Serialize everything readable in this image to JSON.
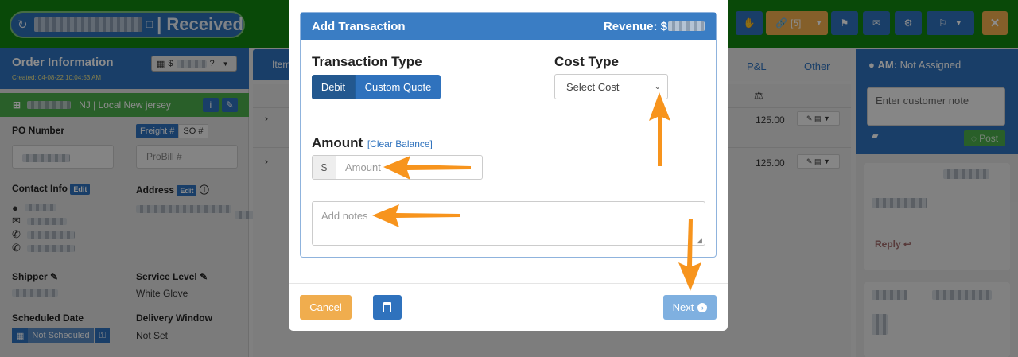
{
  "header": {
    "order_status": "Received",
    "toolbar": {
      "link_count": "[5]"
    }
  },
  "left_panel": {
    "title": "Order Information",
    "created": "Created: 04-08-22 10:04:53 AM",
    "price_dropdown": "$",
    "location": "NJ | Local New jersey",
    "po_number_label": "PO Number",
    "freight_label": "Freight #",
    "so_label": "SO #",
    "probill_placeholder": "ProBill #",
    "contact_info_label": "Contact Info",
    "address_label": "Address",
    "edit_label": "Edit",
    "shipper_label": "Shipper",
    "service_level_label": "Service Level",
    "service_level_value": "White Glove",
    "scheduled_date_label": "Scheduled Date",
    "scheduled_value": "Not Scheduled",
    "delivery_window_label": "Delivery Window",
    "delivery_window_value": "Not Set"
  },
  "middle": {
    "tab_items": "Item",
    "tab_pl": "P&L",
    "tab_other": "Other",
    "row_amounts": [
      "125.00",
      "125.00"
    ]
  },
  "right_panel": {
    "am_label": "AM:",
    "am_value": "Not Assigned",
    "note_placeholder": "Enter customer note",
    "post_label": "Post",
    "reply_label": "Reply"
  },
  "modal": {
    "title": "Add Transaction",
    "revenue_label": "Revenue: $",
    "transaction_type_label": "Transaction Type",
    "debit_label": "Debit",
    "custom_quote_label": "Custom Quote",
    "cost_type_label": "Cost Type",
    "cost_select_value": "Select Cost",
    "amount_label": "Amount",
    "clear_balance_label": "[Clear Balance]",
    "currency_symbol": "$",
    "amount_placeholder": "Amount",
    "notes_placeholder": "Add notes",
    "cancel_label": "Cancel",
    "next_label": "Next"
  }
}
